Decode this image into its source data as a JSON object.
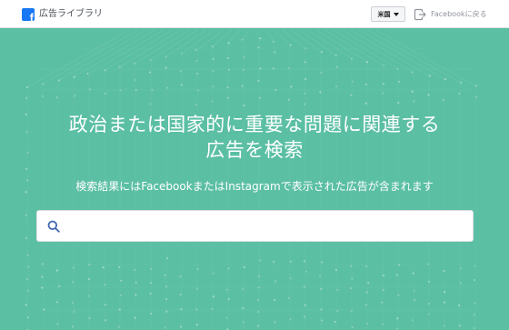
{
  "header": {
    "logo_letter": "f",
    "title": "広告ライブラリ",
    "country": "米国",
    "back_link": "Facebookに戻る"
  },
  "hero": {
    "title_line1": "政治または国家的に重要な問題に関連する",
    "title_line2": "広告を検索",
    "subtitle": "検索結果にはFacebookまたはInstagramで表示された広告が含まれます",
    "search": {
      "placeholder": "",
      "value": ""
    }
  },
  "icons": {
    "logo": "facebook-logo-icon",
    "dropdown": "caret-down-icon",
    "back": "exit-icon",
    "search": "search-icon"
  },
  "colors": {
    "hero_background": "#5bbfa4",
    "facebook_blue": "#1877f2",
    "search_icon": "#4267b2",
    "dot_pattern": "#ffffff"
  }
}
